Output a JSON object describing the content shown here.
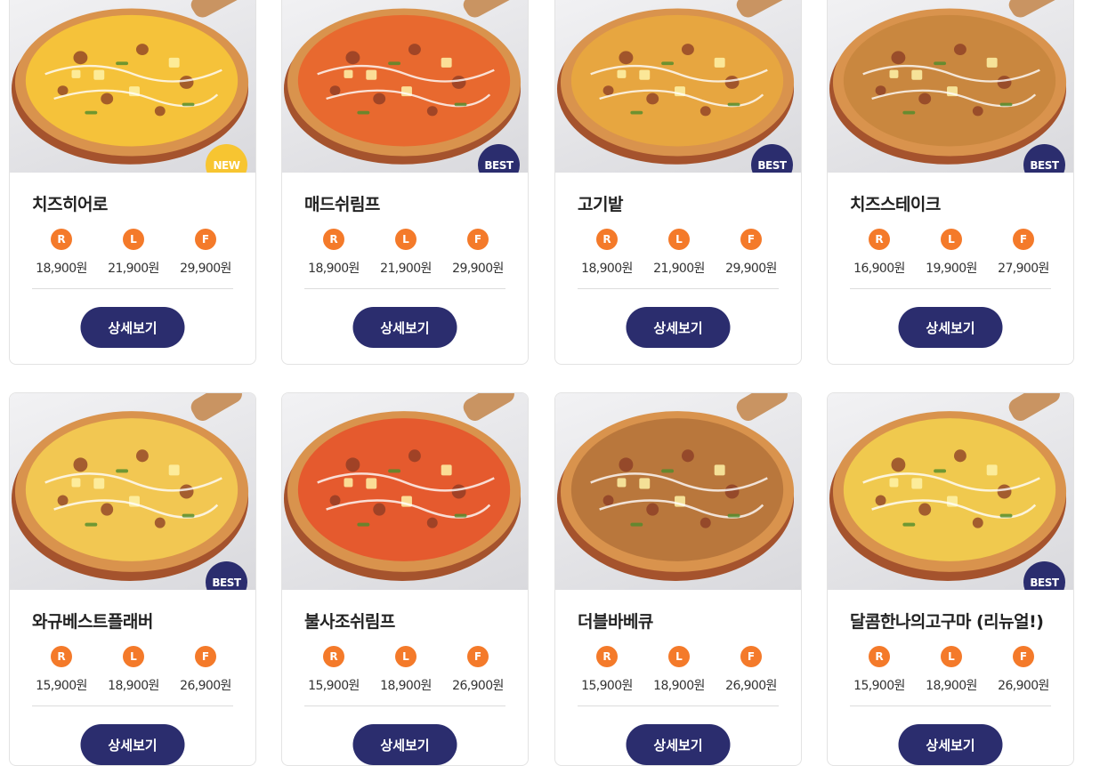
{
  "size_icons": {
    "regular": "R",
    "large": "L",
    "family": "F"
  },
  "colors": {
    "navy": "#2b2d6e",
    "orange": "#f47a2a",
    "new_badge": "#f7c531"
  },
  "products": [
    {
      "name": "치즈히어로",
      "badge": "NEW",
      "badge_type": "new",
      "prices": [
        "18,900원",
        "21,900원",
        "29,900원"
      ],
      "button": "상세보기",
      "topping": "#f5c23a"
    },
    {
      "name": "매드쉬림프",
      "badge": "BEST",
      "badge_type": "best",
      "prices": [
        "18,900원",
        "21,900원",
        "29,900원"
      ],
      "button": "상세보기",
      "topping": "#e8692f"
    },
    {
      "name": "고기밭",
      "badge": "BEST",
      "badge_type": "best",
      "prices": [
        "18,900원",
        "21,900원",
        "29,900원"
      ],
      "button": "상세보기",
      "topping": "#e7a640"
    },
    {
      "name": "치즈스테이크",
      "badge": "BEST",
      "badge_type": "best",
      "prices": [
        "16,900원",
        "19,900원",
        "27,900원"
      ],
      "button": "상세보기",
      "topping": "#c9873f"
    },
    {
      "name": "와규베스트플래버",
      "badge": "BEST",
      "badge_type": "best",
      "prices": [
        "15,900원",
        "18,900원",
        "26,900원"
      ],
      "button": "상세보기",
      "topping": "#f2c752"
    },
    {
      "name": "불사조쉬림프",
      "badge": "",
      "badge_type": "none",
      "prices": [
        "15,900원",
        "18,900원",
        "26,900원"
      ],
      "button": "상세보기",
      "topping": "#e55a2e"
    },
    {
      "name": "더블바베큐",
      "badge": "",
      "badge_type": "none",
      "prices": [
        "15,900원",
        "18,900원",
        "26,900원"
      ],
      "button": "상세보기",
      "topping": "#b9773c"
    },
    {
      "name": "달콤한나의고구마 (리뉴얼!)",
      "badge": "BEST",
      "badge_type": "best",
      "prices": [
        "15,900원",
        "18,900원",
        "26,900원"
      ],
      "button": "상세보기",
      "topping": "#f0c94e"
    }
  ]
}
